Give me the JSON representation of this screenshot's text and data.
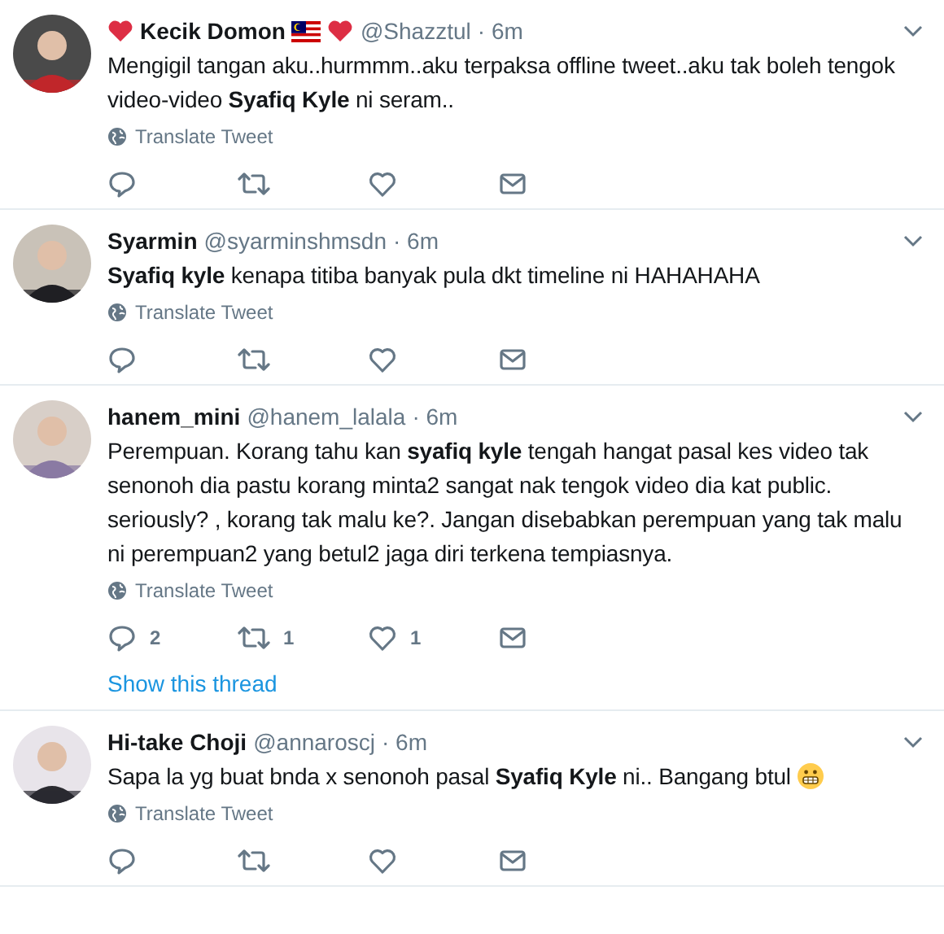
{
  "tweets": [
    {
      "display_name": "Kecik Domon",
      "heart_before_name": true,
      "flag_after_name": true,
      "heart_after_name": true,
      "handle": "@Shazztul",
      "time": "· 6m",
      "text": "Mengigil tangan aku..hurmmm..aku terpaksa offline tweet..aku tak boleh tengok video-video **Syafiq Kyle** ni seram..",
      "translate": "Translate Tweet",
      "actions": [
        {
          "kind": "reply"
        },
        {
          "kind": "retweet"
        },
        {
          "kind": "like"
        },
        {
          "kind": "message"
        }
      ]
    },
    {
      "display_name": "Syarmin",
      "handle": "@syarminshmsdn",
      "time": "· 6m",
      "text": "**Syafiq kyle** kenapa titiba banyak pula dkt timeline ni HAHAHAHA",
      "translate": "Translate Tweet",
      "actions": [
        {
          "kind": "reply"
        },
        {
          "kind": "retweet"
        },
        {
          "kind": "like"
        },
        {
          "kind": "message"
        }
      ]
    },
    {
      "display_name": "hanem_mini",
      "handle": "@hanem_lalala",
      "time": "· 6m",
      "text": "Perempuan. Korang tahu kan **syafiq kyle** tengah hangat pasal kes video tak senonoh dia pastu korang minta2 sangat nak tengok video dia kat public. seriously? , korang tak malu ke?. Jangan disebabkan perempuan yang tak malu ni perempuan2 yang betul2 jaga diri terkena tempiasnya.",
      "translate": "Translate Tweet",
      "actions": [
        {
          "kind": "reply",
          "count": "2"
        },
        {
          "kind": "retweet",
          "count": "1"
        },
        {
          "kind": "like",
          "count": "1"
        },
        {
          "kind": "message"
        }
      ],
      "thread_link": "Show this thread"
    },
    {
      "display_name": "Hi-take Choji",
      "handle": "@annaroscj",
      "time": "· 6m",
      "text": "Sapa la yg buat bnda x senonoh pasal **Syafiq Kyle** ni..  Bangang btul",
      "grimace_emoji": true,
      "translate": "Translate Tweet",
      "actions": [
        {
          "kind": "reply"
        },
        {
          "kind": "retweet"
        },
        {
          "kind": "like"
        },
        {
          "kind": "message"
        }
      ]
    }
  ]
}
